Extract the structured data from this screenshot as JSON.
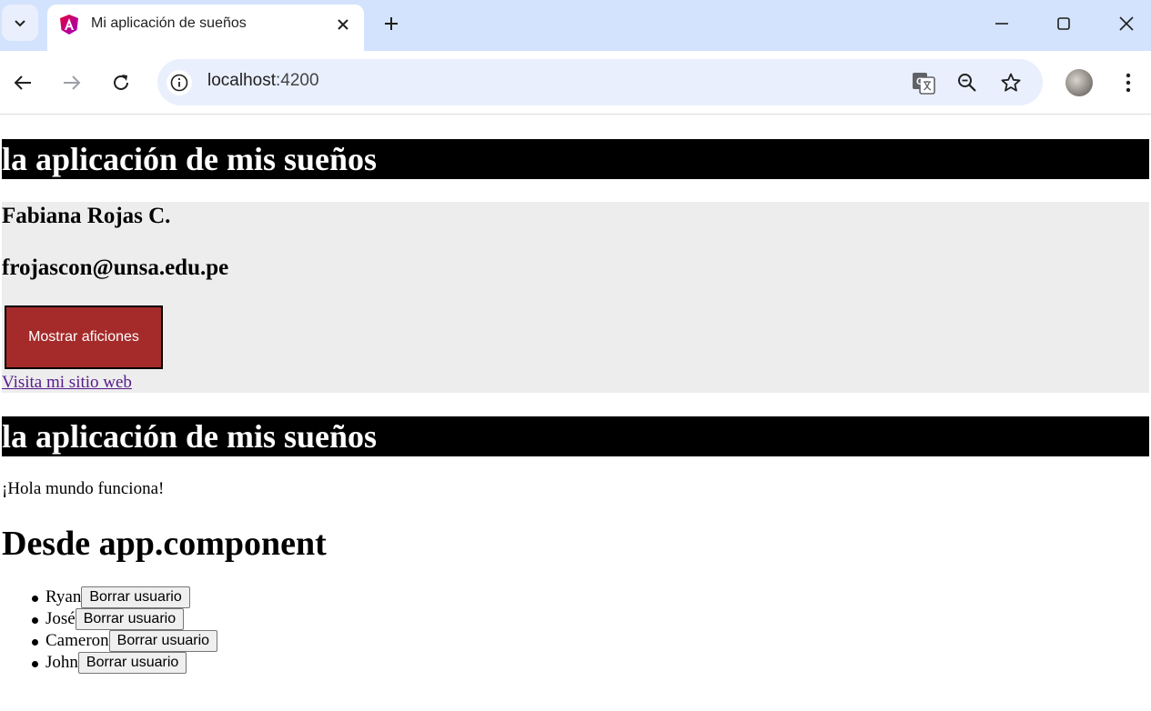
{
  "browser": {
    "tab_title": "Mi aplicación de sueños",
    "url_host": "localhost",
    "url_port": ":4200"
  },
  "page": {
    "banner_1": "la aplicación de mis sueños",
    "profile": {
      "name": "Fabiana Rojas C.",
      "email": "frojascon@unsa.edu.pe",
      "button_label": "Mostrar aficiones",
      "link_text": "Visita mi sitio web"
    },
    "banner_2": "la aplicación de mis sueños",
    "hello_text": "¡Hola mundo funciona!",
    "section_heading": "Desde app.component",
    "users": [
      {
        "name": "Ryan",
        "button": "Borrar usuario"
      },
      {
        "name": "José",
        "button": "Borrar usuario"
      },
      {
        "name": "Cameron",
        "button": "Borrar usuario"
      },
      {
        "name": "John",
        "button": "Borrar usuario"
      }
    ]
  },
  "colors": {
    "tabbar_bg": "#d3e3fd",
    "banner_bg": "#000000",
    "card_bg": "#ededed",
    "hobby_button_bg": "#a52a2a",
    "link_visited": "#551a8b"
  }
}
